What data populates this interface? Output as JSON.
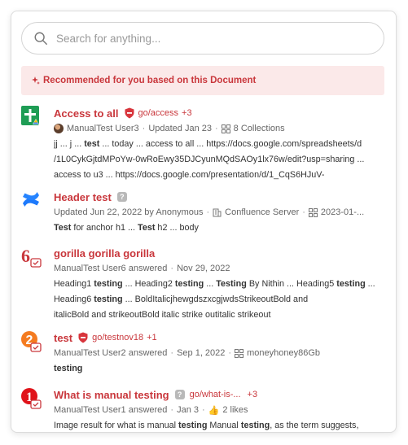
{
  "search": {
    "placeholder": "Search for anything..."
  },
  "banner": {
    "text": "Recommended for you based on this Document",
    "icon": "sparkle-icon"
  },
  "colors": {
    "accent": "#c9373c",
    "banner_bg": "#fbe9e9",
    "meta": "#666666"
  },
  "results": [
    {
      "title": "Access to all",
      "golink": "go/access",
      "golink_more": "+3",
      "author": "ManualTest User3",
      "updated": "Updated Jan 23",
      "collections": "8 Collections",
      "snippet_lines": [
        [
          "jj ... j ... ",
          "test",
          " ... today ... access to all ... https://docs.google.com/spreadsheets/d"
        ],
        [
          "/1L0CykGjtdMPoYw-0wRoEwy35DJCyunMQdSAOy1lx76w/edit?usp=sharing ..."
        ],
        [
          "access to u3 ... https://docs.google.com/presentation/d/1_CqS6HJuV-"
        ]
      ]
    },
    {
      "title": "Header test",
      "updated": "Updated Jun 22, 2022 by Anonymous",
      "source": "Confluence Server",
      "date2": "2023-01-...",
      "snippet_lines": [
        [
          "",
          "Test",
          " for anchor h1 ... ",
          "Test",
          " h2 ... body"
        ]
      ]
    },
    {
      "title": "gorilla gorilla gorilla",
      "answered": "ManualTest User6 answered",
      "date": "Nov 29, 2022",
      "snippet_lines": [
        [
          "Heading1 ",
          "testing",
          " ... Heading2 ",
          "testing",
          " ... ",
          "Testing",
          " By Nithin ... Heading5 ",
          "testing",
          " ..."
        ],
        [
          "Heading6 ",
          "testing",
          " ... BoldItalicjhewgdszxcgjwdsStrikeoutBold and"
        ],
        [
          "italicBold and strikeoutBold italic strike outitalic strikeout"
        ]
      ]
    },
    {
      "title": "test",
      "golink": "go/testnov18",
      "golink_more": "+1",
      "answered": "ManualTest User2 answered",
      "date": "Sep 1, 2022",
      "collection": "moneyhoney86Gb",
      "snippet_lines": [
        [
          "",
          "testing",
          ""
        ]
      ]
    },
    {
      "title": "What is manual testing",
      "golink": "go/what-is-...",
      "golink_more": "+3",
      "answered": "ManualTest User1 answered",
      "date": "Jan 3",
      "likes": "2 likes",
      "snippet_lines": [
        [
          "Image result for what is manual ",
          "testing",
          " Manual ",
          "testing",
          ", as the term suggests,"
        ]
      ]
    }
  ]
}
